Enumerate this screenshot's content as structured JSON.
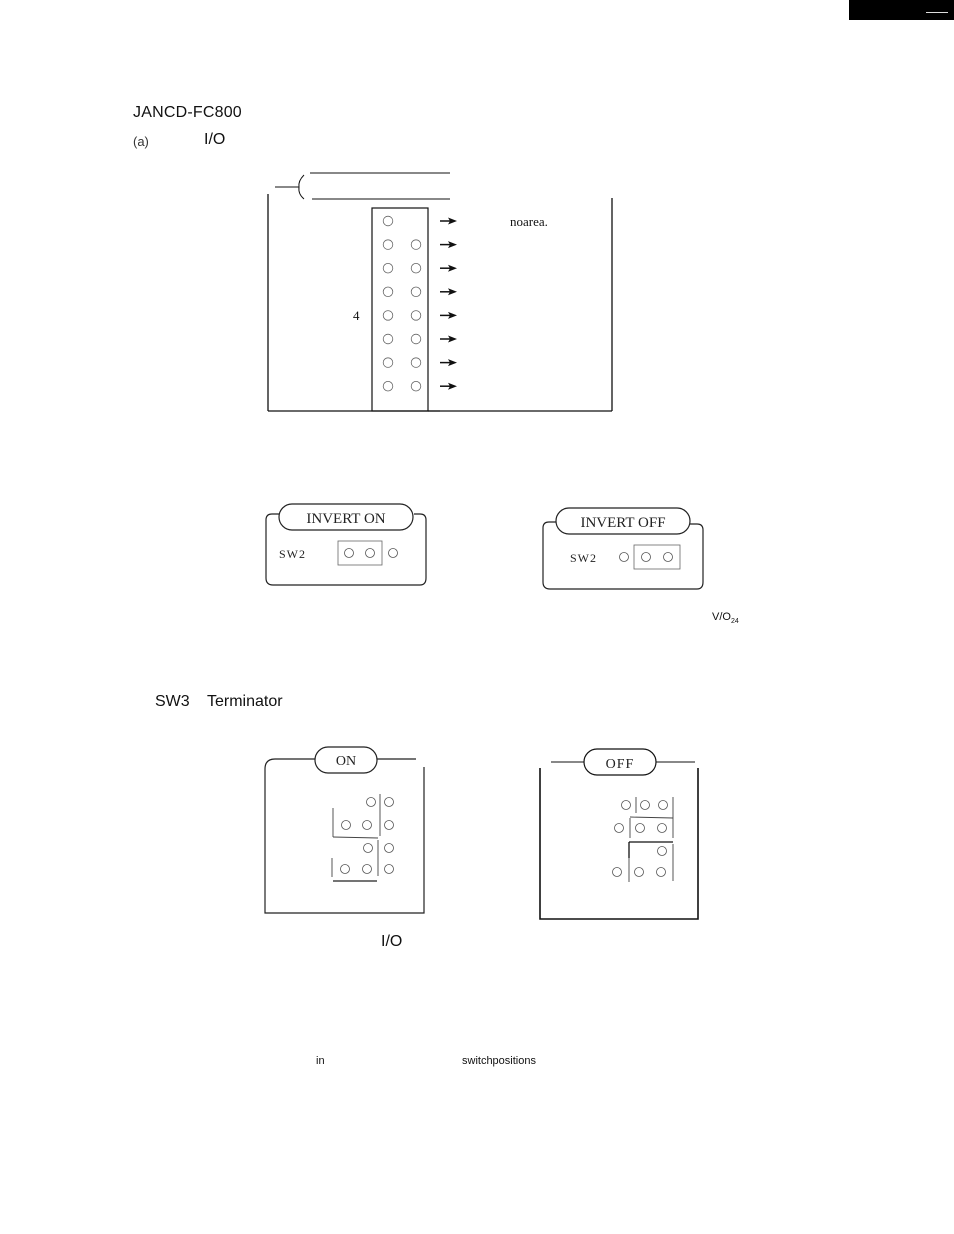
{
  "page": {
    "heading": "JANCD-FC800",
    "subsection_label": "(a)",
    "subsection_io": "I/O",
    "footer_io": "I/O",
    "footer_in": "in",
    "footer_switch_positions": "switchpositions",
    "vo_label": "V/O",
    "vo_subscript": "24"
  },
  "connector_diagram": {
    "note_text": "noarea.",
    "side_number": "4",
    "rows": [
      {
        "left_pin": true,
        "right_pin": false
      },
      {
        "left_pin": true,
        "right_pin": true
      },
      {
        "left_pin": true,
        "right_pin": true
      },
      {
        "left_pin": true,
        "right_pin": true
      },
      {
        "left_pin": true,
        "right_pin": true
      },
      {
        "left_pin": true,
        "right_pin": true
      },
      {
        "left_pin": true,
        "right_pin": true
      },
      {
        "left_pin": true,
        "right_pin": true
      }
    ]
  },
  "sw2_settings": [
    {
      "title": "INVERT ON",
      "switch_label": "SW2",
      "jumper": "left-pair"
    },
    {
      "title": "INVERT OFF",
      "switch_label": "SW2",
      "jumper": "right-pair"
    }
  ],
  "sw3_section": {
    "label": "SW3",
    "title": "Terminator",
    "settings": [
      {
        "title": "ON"
      },
      {
        "title": "OFF"
      }
    ]
  }
}
